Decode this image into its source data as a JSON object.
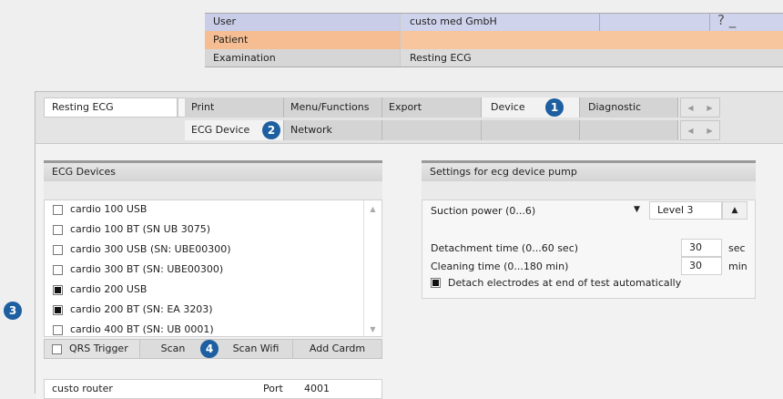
{
  "header": {
    "user_label": "User",
    "user_value": "custo med GmbH",
    "patient_label": "Patient",
    "patient_value": "",
    "exam_label": "Examination",
    "exam_value": "Resting ECG",
    "help_label": "?",
    "minimize_label": "_"
  },
  "toolbar": {
    "exam_select": "Resting ECG",
    "tabs": [
      "Print",
      "Menu/Functions",
      "Export",
      "Device",
      "Diagnostic"
    ],
    "subtabs": [
      "ECG Device",
      "Network"
    ]
  },
  "badges": [
    "1",
    "2",
    "3",
    "4"
  ],
  "devices": {
    "title": "ECG Devices",
    "items": [
      {
        "label": "cardio 100 USB",
        "checked": false
      },
      {
        "label": "cardio 100 BT (SN UB 3075)",
        "checked": false
      },
      {
        "label": "cardio 300 USB (SN: UBE00300)",
        "checked": false
      },
      {
        "label": "cardio 300 BT (SN: UBE00300)",
        "checked": false
      },
      {
        "label": "cardio 200 USB",
        "checked": true
      },
      {
        "label": "cardio 200 BT (SN: EA 3203)",
        "checked": true
      },
      {
        "label": "cardio 400 BT (SN: UB 0001)",
        "checked": false
      }
    ],
    "qrs_label": "QRS Trigger",
    "scan_label": "Scan",
    "scan_wifi_label": "Scan Wifi",
    "add_cardm_label": "Add Cardm",
    "router_label": "custo router",
    "port_label": "Port",
    "port_value": "4001"
  },
  "pump": {
    "title": "Settings for ecg device pump",
    "suction_label": "Suction power (0...6)",
    "suction_value": "Level 3",
    "detach_label": "Detachment time (0...60 sec)",
    "detach_value": "30",
    "detach_unit": "sec",
    "clean_label": "Cleaning time (0...180 min)",
    "clean_value": "30",
    "clean_unit": "min",
    "auto_label": "Detach electrodes at end of test automatically",
    "auto_checked": true
  },
  "colors": {
    "badge": "#1d5fa0",
    "user_row": "#cfd3ec",
    "patient_row": "#f8c69e"
  }
}
